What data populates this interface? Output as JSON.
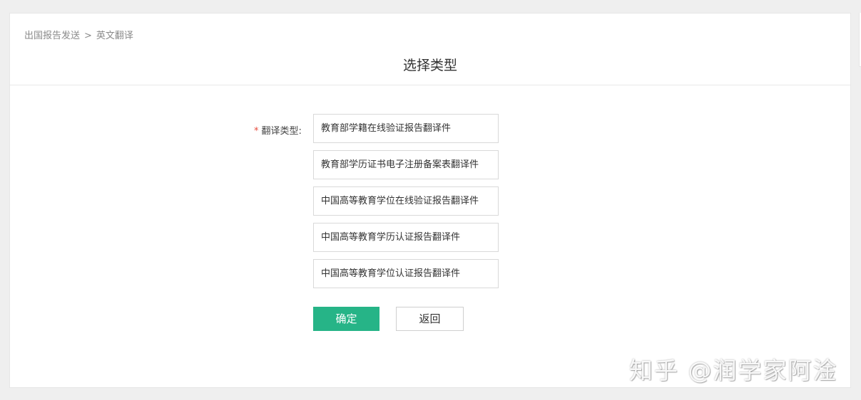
{
  "breadcrumb": {
    "parent": "出国报告发送",
    "separator": ">",
    "current": "英文翻译"
  },
  "page": {
    "title": "选择类型"
  },
  "form": {
    "required_mark": "*",
    "label": "翻译类型:",
    "options": [
      "教育部学籍在线验证报告翻译件",
      "教育部学历证书电子注册备案表翻译件",
      "中国高等教育学位在线验证报告翻译件",
      "中国高等教育学历认证报告翻译件",
      "中国高等教育学位认证报告翻译件"
    ]
  },
  "buttons": {
    "confirm": "确定",
    "back": "返回"
  },
  "watermark": {
    "text": "知乎 @润学家阿淦"
  },
  "colors": {
    "accent": "#26b487",
    "required": "#e64b3c",
    "page_background": "#efefef"
  }
}
